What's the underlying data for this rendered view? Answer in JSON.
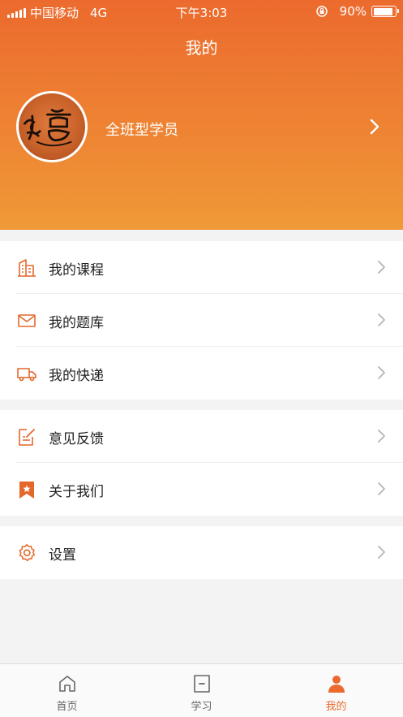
{
  "status_bar": {
    "carrier": "中国移动",
    "network": "4G",
    "time": "下午3:03",
    "battery": "90%",
    "battery_level": 0.9
  },
  "header": {
    "title": "我的",
    "user_name": "全班型学员"
  },
  "menu_groups": [
    [
      {
        "label": "我的课程",
        "icon": "building-icon"
      },
      {
        "label": "我的题库",
        "icon": "mail-icon"
      },
      {
        "label": "我的快递",
        "icon": "truck-icon"
      }
    ],
    [
      {
        "label": "意见反馈",
        "icon": "edit-icon"
      },
      {
        "label": "关于我们",
        "icon": "bookmark-star-icon"
      }
    ],
    [
      {
        "label": "设置",
        "icon": "gear-icon"
      }
    ]
  ],
  "tabs": [
    {
      "label": "首页",
      "icon": "home-icon"
    },
    {
      "label": "学习",
      "icon": "study-icon"
    },
    {
      "label": "我的",
      "icon": "person-icon",
      "active": true
    }
  ],
  "colors": {
    "accent": "#ec6a2e",
    "header_bottom": "#f09a38",
    "icon": "#e4672b"
  }
}
